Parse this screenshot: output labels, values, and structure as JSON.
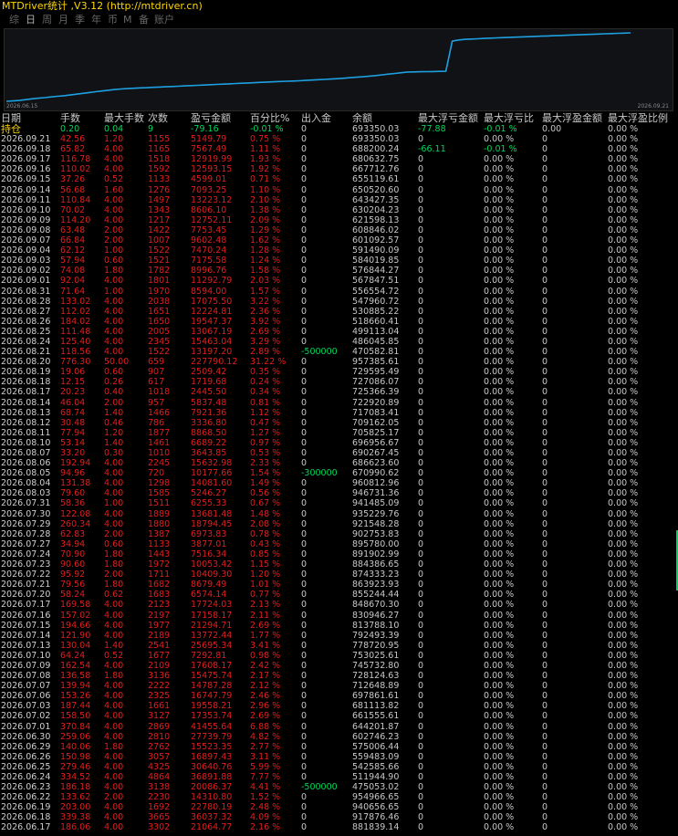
{
  "title": "MTDriver统计 ,V3.12 (http://mtdriver.cn)",
  "tabs": [
    "综",
    "日",
    "周",
    "月",
    "季",
    "年",
    "币",
    "M",
    "备",
    "账户"
  ],
  "active_tab": 1,
  "chart_data": {
    "type": "line",
    "x_start": "2026.06.15",
    "x_end": "2026.09.21",
    "color": "#1ea0e0",
    "values": [
      433000,
      436000,
      440000,
      447000,
      454000,
      459000,
      464000,
      470000,
      475000,
      480000,
      486000,
      493000,
      500000,
      507000,
      514000,
      520000,
      526000,
      532000,
      537000,
      540000,
      543000,
      546000,
      548000,
      551000,
      553000,
      555000,
      558000,
      560000,
      563000,
      565000,
      568000,
      570000,
      573000,
      575000,
      578000,
      580000,
      583000,
      585000,
      588000,
      590000,
      593000,
      595000,
      598000,
      600000,
      602000,
      604000,
      606000,
      609000,
      612000,
      615000,
      618000,
      621000,
      624000,
      628000,
      632000,
      636000,
      640000,
      645000,
      650000,
      656000,
      662000,
      668000,
      674000,
      680000,
      681000,
      682000,
      683000,
      684000,
      685000,
      686000,
      940000,
      950000,
      955000,
      958000,
      960000,
      963000,
      965000,
      968000,
      970000,
      972000,
      974000,
      976000,
      978000,
      980000,
      982000,
      984000,
      986000,
      988000,
      990000,
      992000,
      994000,
      996000,
      998000,
      1000000,
      1002000,
      1004000,
      1006000,
      1008000,
      1010000
    ]
  },
  "headers": [
    "日期",
    "手数",
    "最大手数",
    "次数",
    "盈亏金额",
    "百分比%",
    "出入金",
    "余额",
    "最大浮亏金额",
    "最大浮亏比",
    "最大浮盈金额",
    "最大浮盈比例"
  ],
  "hold_row": {
    "date": "持仓",
    "lots": "0.20",
    "max_lots": "0.04",
    "count": "9",
    "pnl": "-79.16",
    "pct": "-0.01 %",
    "io": "0",
    "balance": "693350.03",
    "max_dd_amt": "-77.88",
    "max_dd_pct": "-0.01 %",
    "max_fp_amt": "0.00",
    "max_fp_pct": "0.00 %"
  },
  "rows": [
    [
      "2026.09.21",
      "42.56",
      "1.20",
      "1155",
      "5149.79",
      "0.75 %",
      "0",
      "693350.03",
      "0",
      "0.00 %",
      "0",
      "0.00 %"
    ],
    [
      "2026.09.18",
      "65.82",
      "4.00",
      "1165",
      "7567.49",
      "1.11 %",
      "0",
      "688200.24",
      "-66.11",
      "-0.01 %",
      "0",
      "0.00 %"
    ],
    [
      "2026.09.17",
      "116.78",
      "4.00",
      "1518",
      "12919.99",
      "1.93 %",
      "0",
      "680632.75",
      "0",
      "0.00 %",
      "0",
      "0.00 %"
    ],
    [
      "2026.09.16",
      "110.02",
      "4.00",
      "1592",
      "12593.15",
      "1.92 %",
      "0",
      "667712.76",
      "0",
      "0.00 %",
      "0",
      "0.00 %"
    ],
    [
      "2026.09.15",
      "37.26",
      "0.52",
      "1133",
      "4599.01",
      "0.71 %",
      "0",
      "655119.61",
      "0",
      "0.00 %",
      "0",
      "0.00 %"
    ],
    [
      "2026.09.14",
      "56.68",
      "1.60",
      "1276",
      "7093.25",
      "1.10 %",
      "0",
      "650520.60",
      "0",
      "0.00 %",
      "0",
      "0.00 %"
    ],
    [
      "2026.09.11",
      "110.84",
      "4.00",
      "1497",
      "13223.12",
      "2.10 %",
      "0",
      "643427.35",
      "0",
      "0.00 %",
      "0",
      "0.00 %"
    ],
    [
      "2026.09.10",
      "70.02",
      "4.00",
      "1343",
      "8606.10",
      "1.38 %",
      "0",
      "630204.23",
      "0",
      "0.00 %",
      "0",
      "0.00 %"
    ],
    [
      "2026.09.09",
      "114.20",
      "4.00",
      "1217",
      "12752.11",
      "2.09 %",
      "0",
      "621598.13",
      "0",
      "0.00 %",
      "0",
      "0.00 %"
    ],
    [
      "2026.09.08",
      "63.48",
      "2.00",
      "1422",
      "7753.45",
      "1.29 %",
      "0",
      "608846.02",
      "0",
      "0.00 %",
      "0",
      "0.00 %"
    ],
    [
      "2026.09.07",
      "66.84",
      "2.00",
      "1007",
      "9602.48",
      "1.62 %",
      "0",
      "601092.57",
      "0",
      "0.00 %",
      "0",
      "0.00 %"
    ],
    [
      "2026.09.04",
      "62.12",
      "1.00",
      "1522",
      "7470.24",
      "1.28 %",
      "0",
      "591490.09",
      "0",
      "0.00 %",
      "0",
      "0.00 %"
    ],
    [
      "2026.09.03",
      "57.94",
      "0.60",
      "1521",
      "7175.58",
      "1.24 %",
      "0",
      "584019.85",
      "0",
      "0.00 %",
      "0",
      "0.00 %"
    ],
    [
      "2026.09.02",
      "74.08",
      "1.80",
      "1782",
      "8996.76",
      "1.58 %",
      "0",
      "576844.27",
      "0",
      "0.00 %",
      "0",
      "0.00 %"
    ],
    [
      "2026.09.01",
      "92.04",
      "4.00",
      "1801",
      "11292.79",
      "2.03 %",
      "0",
      "567847.51",
      "0",
      "0.00 %",
      "0",
      "0.00 %"
    ],
    [
      "2026.08.31",
      "71.64",
      "1.00",
      "1970",
      "8594.00",
      "1.57 %",
      "0",
      "556554.72",
      "0",
      "0.00 %",
      "0",
      "0.00 %"
    ],
    [
      "2026.08.28",
      "133.02",
      "4.00",
      "2038",
      "17075.50",
      "3.22 %",
      "0",
      "547960.72",
      "0",
      "0.00 %",
      "0",
      "0.00 %"
    ],
    [
      "2026.08.27",
      "112.02",
      "4.00",
      "1651",
      "12224.81",
      "2.36 %",
      "0",
      "530885.22",
      "0",
      "0.00 %",
      "0",
      "0.00 %"
    ],
    [
      "2026.08.26",
      "184.02",
      "4.00",
      "1650",
      "19547.37",
      "3.92 %",
      "0",
      "518660.41",
      "0",
      "0.00 %",
      "0",
      "0.00 %"
    ],
    [
      "2026.08.25",
      "111.48",
      "4.00",
      "2005",
      "13067.19",
      "2.69 %",
      "0",
      "499113.04",
      "0",
      "0.00 %",
      "0",
      "0.00 %"
    ],
    [
      "2026.08.24",
      "125.40",
      "4.00",
      "2345",
      "15463.04",
      "3.29 %",
      "0",
      "486045.85",
      "0",
      "0.00 %",
      "0",
      "0.00 %"
    ],
    [
      "2026.08.21",
      "118.56",
      "4.00",
      "1522",
      "13197.20",
      "2.89 %",
      "-500000",
      "470582.81",
      "0",
      "0.00 %",
      "0",
      "0.00 %"
    ],
    [
      "2026.08.20",
      "776.30",
      "50.00",
      "659",
      "227790.12",
      "31.22 %",
      "0",
      "957385.61",
      "0",
      "0.00 %",
      "0",
      "0.00 %"
    ],
    [
      "2026.08.19",
      "19.06",
      "0.60",
      "907",
      "2509.42",
      "0.35 %",
      "0",
      "729595.49",
      "0",
      "0.00 %",
      "0",
      "0.00 %"
    ],
    [
      "2026.08.18",
      "12.15",
      "0.26",
      "617",
      "1719.68",
      "0.24 %",
      "0",
      "727086.07",
      "0",
      "0.00 %",
      "0",
      "0.00 %"
    ],
    [
      "2026.08.17",
      "20.23",
      "0.40",
      "1018",
      "2445.50",
      "0.34 %",
      "0",
      "725366.39",
      "0",
      "0.00 %",
      "0",
      "0.00 %"
    ],
    [
      "2026.08.14",
      "46.04",
      "2.00",
      "957",
      "5837.48",
      "0.81 %",
      "0",
      "722920.89",
      "0",
      "0.00 %",
      "0",
      "0.00 %"
    ],
    [
      "2026.08.13",
      "68.74",
      "1.40",
      "1466",
      "7921.36",
      "1.12 %",
      "0",
      "717083.41",
      "0",
      "0.00 %",
      "0",
      "0.00 %"
    ],
    [
      "2026.08.12",
      "30.48",
      "0.46",
      "786",
      "3336.80",
      "0.47 %",
      "0",
      "709162.05",
      "0",
      "0.00 %",
      "0",
      "0.00 %"
    ],
    [
      "2026.08.11",
      "77.94",
      "1.20",
      "1877",
      "8868.50",
      "1.27 %",
      "0",
      "705825.17",
      "0",
      "0.00 %",
      "0",
      "0.00 %"
    ],
    [
      "2026.08.10",
      "53.14",
      "1.40",
      "1461",
      "6689.22",
      "0.97 %",
      "0",
      "696956.67",
      "0",
      "0.00 %",
      "0",
      "0.00 %"
    ],
    [
      "2026.08.07",
      "33.20",
      "0.30",
      "1010",
      "3643.85",
      "0.53 %",
      "0",
      "690267.45",
      "0",
      "0.00 %",
      "0",
      "0.00 %"
    ],
    [
      "2026.08.06",
      "192.94",
      "4.00",
      "2245",
      "15632.98",
      "2.33 %",
      "0",
      "686623.60",
      "0",
      "0.00 %",
      "0",
      "0.00 %"
    ],
    [
      "2026.08.05",
      "94.96",
      "4.00",
      "720",
      "10177.66",
      "1.54 %",
      "-300000",
      "670990.62",
      "0",
      "0.00 %",
      "0",
      "0.00 %"
    ],
    [
      "2026.08.04",
      "131.38",
      "4.00",
      "1298",
      "14081.60",
      "1.49 %",
      "0",
      "960812.96",
      "0",
      "0.00 %",
      "0",
      "0.00 %"
    ],
    [
      "2026.08.03",
      "79.60",
      "4.00",
      "1585",
      "5246.27",
      "0.56 %",
      "0",
      "946731.36",
      "0",
      "0.00 %",
      "0",
      "0.00 %"
    ],
    [
      "2026.07.31",
      "58.36",
      "1.00",
      "1511",
      "6255.33",
      "0.67 %",
      "0",
      "941485.09",
      "0",
      "0.00 %",
      "0",
      "0.00 %"
    ],
    [
      "2026.07.30",
      "122.08",
      "4.00",
      "1889",
      "13681.48",
      "1.48 %",
      "0",
      "935229.76",
      "0",
      "0.00 %",
      "0",
      "0.00 %"
    ],
    [
      "2026.07.29",
      "260.34",
      "4.00",
      "1880",
      "18794.45",
      "2.08 %",
      "0",
      "921548.28",
      "0",
      "0.00 %",
      "0",
      "0.00 %"
    ],
    [
      "2026.07.28",
      "62.83",
      "2.00",
      "1387",
      "6973.83",
      "0.78 %",
      "0",
      "902753.83",
      "0",
      "0.00 %",
      "0",
      "0.00 %"
    ],
    [
      "2026.07.27",
      "34.94",
      "0.60",
      "1133",
      "3877.01",
      "0.43 %",
      "0",
      "895780.00",
      "0",
      "0.00 %",
      "0",
      "0.00 %"
    ],
    [
      "2026.07.24",
      "70.90",
      "1.80",
      "1443",
      "7516.34",
      "0.85 %",
      "0",
      "891902.99",
      "0",
      "0.00 %",
      "0",
      "0.00 %"
    ],
    [
      "2026.07.23",
      "90.60",
      "1.80",
      "1972",
      "10053.42",
      "1.15 %",
      "0",
      "884386.65",
      "0",
      "0.00 %",
      "0",
      "0.00 %"
    ],
    [
      "2026.07.22",
      "95.92",
      "2.00",
      "1711",
      "10409.30",
      "1.20 %",
      "0",
      "874333.23",
      "0",
      "0.00 %",
      "0",
      "0.00 %"
    ],
    [
      "2026.07.21",
      "79.56",
      "1.80",
      "1682",
      "8679.49",
      "1.01 %",
      "0",
      "863923.93",
      "0",
      "0.00 %",
      "0",
      "0.00 %"
    ],
    [
      "2026.07.20",
      "58.24",
      "0.62",
      "1683",
      "6574.14",
      "0.77 %",
      "0",
      "855244.44",
      "0",
      "0.00 %",
      "0",
      "0.00 %"
    ],
    [
      "2026.07.17",
      "169.58",
      "4.00",
      "2123",
      "17724.03",
      "2.13 %",
      "0",
      "848670.30",
      "0",
      "0.00 %",
      "0",
      "0.00 %"
    ],
    [
      "2026.07.16",
      "157.02",
      "4.00",
      "2197",
      "17158.17",
      "2.11 %",
      "0",
      "830946.27",
      "0",
      "0.00 %",
      "0",
      "0.00 %"
    ],
    [
      "2026.07.15",
      "194.66",
      "4.00",
      "1977",
      "21294.71",
      "2.69 %",
      "0",
      "813788.10",
      "0",
      "0.00 %",
      "0",
      "0.00 %"
    ],
    [
      "2026.07.14",
      "121.90",
      "4.00",
      "2189",
      "13772.44",
      "1.77 %",
      "0",
      "792493.39",
      "0",
      "0.00 %",
      "0",
      "0.00 %"
    ],
    [
      "2026.07.13",
      "130.04",
      "1.40",
      "2541",
      "25695.34",
      "3.41 %",
      "0",
      "778720.95",
      "0",
      "0.00 %",
      "0",
      "0.00 %"
    ],
    [
      "2026.07.10",
      "64.24",
      "0.52",
      "1677",
      "7292.81",
      "0.98 %",
      "0",
      "753025.61",
      "0",
      "0.00 %",
      "0",
      "0.00 %"
    ],
    [
      "2026.07.09",
      "162.54",
      "4.00",
      "2109",
      "17608.17",
      "2.42 %",
      "0",
      "745732.80",
      "0",
      "0.00 %",
      "0",
      "0.00 %"
    ],
    [
      "2026.07.08",
      "136.58",
      "1.80",
      "3136",
      "15475.74",
      "2.17 %",
      "0",
      "728124.63",
      "0",
      "0.00 %",
      "0",
      "0.00 %"
    ],
    [
      "2026.07.07",
      "139.94",
      "4.00",
      "2222",
      "14787.28",
      "2.12 %",
      "0",
      "712648.89",
      "0",
      "0.00 %",
      "0",
      "0.00 %"
    ],
    [
      "2026.07.06",
      "153.26",
      "4.00",
      "2325",
      "16747.79",
      "2.46 %",
      "0",
      "697861.61",
      "0",
      "0.00 %",
      "0",
      "0.00 %"
    ],
    [
      "2026.07.03",
      "187.44",
      "4.00",
      "1661",
      "19558.21",
      "2.96 %",
      "0",
      "681113.82",
      "0",
      "0.00 %",
      "0",
      "0.00 %"
    ],
    [
      "2026.07.02",
      "158.50",
      "4.00",
      "3127",
      "17353.74",
      "2.69 %",
      "0",
      "661555.61",
      "0",
      "0.00 %",
      "0",
      "0.00 %"
    ],
    [
      "2026.07.01",
      "370.84",
      "4.00",
      "2869",
      "41455.64",
      "6.88 %",
      "0",
      "644201.87",
      "0",
      "0.00 %",
      "0",
      "0.00 %"
    ],
    [
      "2026.06.30",
      "259.06",
      "4.00",
      "2810",
      "27739.79",
      "4.82 %",
      "0",
      "602746.23",
      "0",
      "0.00 %",
      "0",
      "0.00 %"
    ],
    [
      "2026.06.29",
      "140.06",
      "1.80",
      "2762",
      "15523.35",
      "2.77 %",
      "0",
      "575006.44",
      "0",
      "0.00 %",
      "0",
      "0.00 %"
    ],
    [
      "2026.06.26",
      "150.98",
      "4.00",
      "3057",
      "16897.43",
      "3.11 %",
      "0",
      "559483.09",
      "0",
      "0.00 %",
      "0",
      "0.00 %"
    ],
    [
      "2026.06.25",
      "279.46",
      "4.00",
      "4325",
      "30640.76",
      "5.99 %",
      "0",
      "542585.66",
      "0",
      "0.00 %",
      "0",
      "0.00 %"
    ],
    [
      "2026.06.24",
      "334.52",
      "4.00",
      "4864",
      "36891.88",
      "7.77 %",
      "0",
      "511944.90",
      "0",
      "0.00 %",
      "0",
      "0.00 %"
    ],
    [
      "2026.06.23",
      "186.18",
      "4.00",
      "3138",
      "20086.37",
      "4.41 %",
      "-500000",
      "475053.02",
      "0",
      "0.00 %",
      "0",
      "0.00 %"
    ],
    [
      "2026.06.22",
      "133.62",
      "2.00",
      "2230",
      "14310.80",
      "1.52 %",
      "0",
      "954966.65",
      "0",
      "0.00 %",
      "0",
      "0.00 %"
    ],
    [
      "2026.06.19",
      "203.00",
      "4.00",
      "1692",
      "22780.19",
      "2.48 %",
      "0",
      "940656.65",
      "0",
      "0.00 %",
      "0",
      "0.00 %"
    ],
    [
      "2026.06.18",
      "339.38",
      "4.00",
      "3665",
      "36037.32",
      "4.09 %",
      "0",
      "917876.46",
      "0",
      "0.00 %",
      "0",
      "0.00 %"
    ],
    [
      "2026.06.17",
      "186.06",
      "4.00",
      "3302",
      "21064.77",
      "2.16 %",
      "0",
      "881839.14",
      "0",
      "0.00 %",
      "0",
      "0.00 %"
    ]
  ]
}
